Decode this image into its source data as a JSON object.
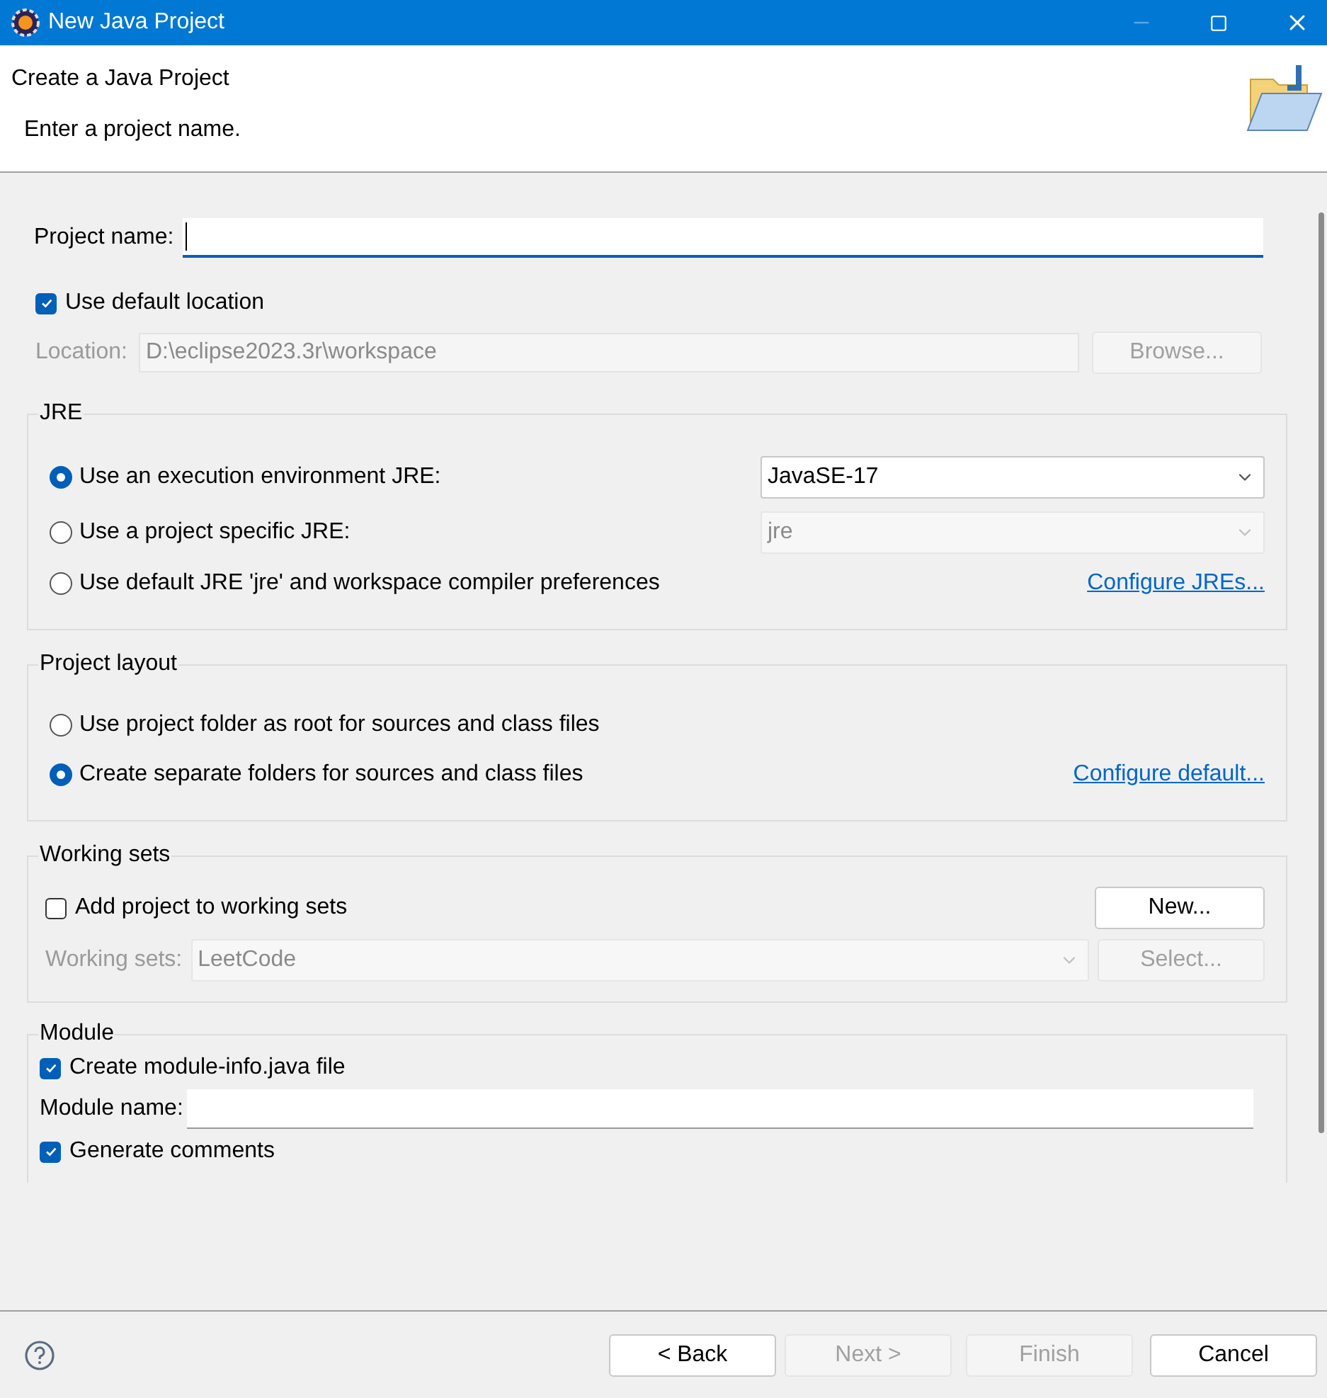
{
  "window": {
    "title": "New Java Project"
  },
  "header": {
    "title": "Create a Java Project",
    "message": "Enter a project name."
  },
  "project_name": {
    "label": "Project name:"
  },
  "default_location": {
    "label": "Use default location",
    "checked": true
  },
  "location": {
    "label": "Location:",
    "value": "D:\\eclipse2023.3r\\workspace",
    "disabled": true,
    "button": {
      "label": "Browse...",
      "disabled": true
    }
  },
  "jre": {
    "title": "JRE",
    "options": [
      {
        "kind": "select",
        "label": "Use an execution environment JRE:",
        "selected": true,
        "select": {
          "value": "JavaSE-17",
          "disabled": false
        }
      },
      {
        "kind": "select",
        "label": "Use a project specific JRE:",
        "selected": false,
        "select": {
          "value": "jre",
          "disabled": true
        }
      },
      {
        "kind": "link",
        "label": "Use default JRE 'jre' and workspace compiler preferences",
        "selected": false,
        "link": "Configure JREs..."
      }
    ]
  },
  "project_layout": {
    "title": "Project layout",
    "options": [
      {
        "kind": "plain",
        "label": "Use project folder as root for sources and class files",
        "selected": false
      },
      {
        "kind": "link",
        "label": "Create separate folders for sources and class files",
        "selected": true,
        "link": "Configure default..."
      }
    ]
  },
  "working_sets": {
    "title": "Working sets",
    "checkbox": {
      "label": "Add project to working sets",
      "checked": false
    },
    "new_button": {
      "label": "New...",
      "disabled": false
    },
    "field": {
      "label": "Working sets:",
      "value": "LeetCode",
      "disabled": true
    },
    "select_button": {
      "label": "Select...",
      "disabled": true
    }
  },
  "module": {
    "title": "Module",
    "create": {
      "label": "Create module-info.java file",
      "checked": true
    },
    "name": {
      "label": "Module name:"
    },
    "comments": {
      "label": "Generate comments",
      "checked": true
    }
  },
  "buttons": [
    {
      "label": "< Back",
      "disabled": false
    },
    {
      "label": "Next >",
      "disabled": true
    },
    {
      "label": "Finish",
      "disabled": true
    },
    {
      "label": "Cancel",
      "disabled": false
    }
  ]
}
